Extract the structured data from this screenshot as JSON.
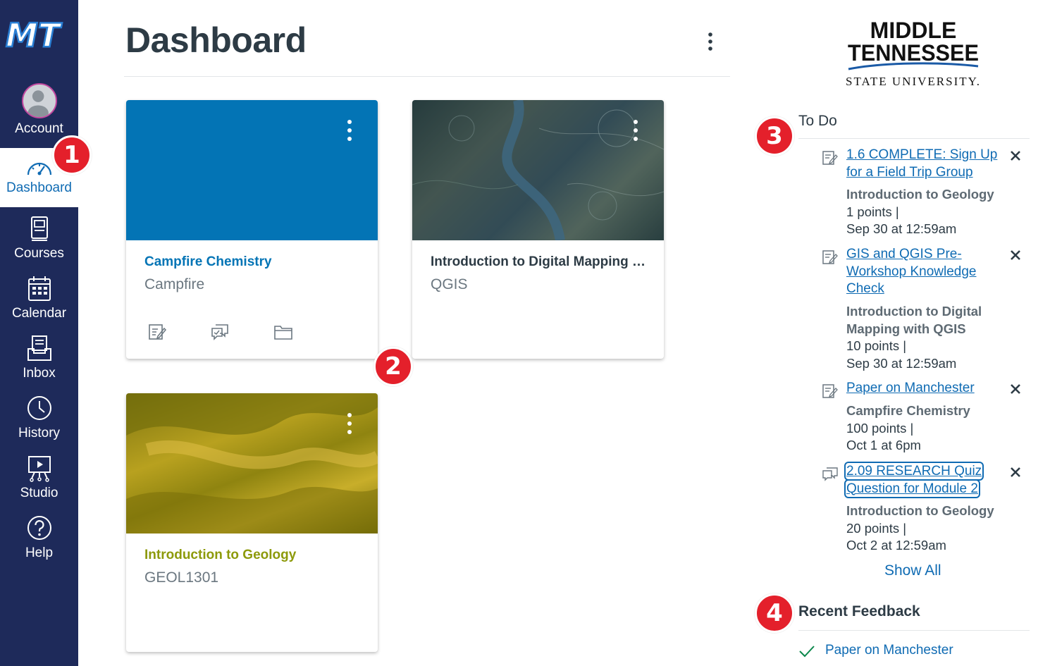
{
  "nav": {
    "logo_text": "MT",
    "items": [
      {
        "label": "Account",
        "icon": "account-avatar"
      },
      {
        "label": "Dashboard",
        "icon": "dashboard-icon",
        "active": true
      },
      {
        "label": "Courses",
        "icon": "courses-icon"
      },
      {
        "label": "Calendar",
        "icon": "calendar-icon"
      },
      {
        "label": "Inbox",
        "icon": "inbox-icon"
      },
      {
        "label": "History",
        "icon": "history-icon"
      },
      {
        "label": "Studio",
        "icon": "studio-icon"
      },
      {
        "label": "Help",
        "icon": "help-icon"
      }
    ]
  },
  "header": {
    "title": "Dashboard"
  },
  "cards": [
    {
      "title": "Campfire Chemistry",
      "subtitle": "Campfire",
      "color": "#0374b5"
    },
    {
      "title": "Introduction to Digital Mapping w...",
      "subtitle": "QGIS",
      "color": "#2d3b45"
    },
    {
      "title": "Introduction to Geology",
      "subtitle": "GEOL1301",
      "color": "#8d9a0b"
    }
  ],
  "badges": [
    "1",
    "2",
    "3",
    "4"
  ],
  "brand": {
    "line1": "MIDDLE",
    "line2": "TENNESSEE",
    "line3": "STATE UNIVERSITY."
  },
  "todo": {
    "heading": "To Do",
    "items": [
      {
        "link_l1": "1.6 COMPLETE: Sign Up",
        "link_l2": "for a Field Trip Group",
        "course_l1": "Introduction to Geology",
        "points": "1 points  |",
        "due": "Sep 30 at 12:59am",
        "icon": "assignment-icon"
      },
      {
        "link_l1": "GIS and QGIS Pre-",
        "link_l2": "Workshop Knowledge",
        "link_l3": "Check",
        "course_l1": "Introduction to Digital",
        "course_l2": "Mapping with QGIS",
        "points": "10 points  |",
        "due": "Sep 30 at 12:59am",
        "icon": "assignment-icon"
      },
      {
        "link_l1": "Paper on Manchester",
        "course_l1": "Campfire Chemistry",
        "points": "100 points  |",
        "due": "Oct 1 at 6pm",
        "icon": "assignment-icon"
      },
      {
        "link_l1": "2.09 RESEARCH Quiz",
        "link_l2": "Question for Module 2",
        "course_l1": "Introduction to Geology",
        "points": "20 points  |",
        "due": "Oct 2 at 12:59am",
        "icon": "discussion-icon"
      }
    ],
    "show_all": "Show All"
  },
  "feedback": {
    "heading": "Recent Feedback",
    "items": [
      {
        "title": "Paper on Manchester",
        "color": "#0b874b"
      }
    ]
  }
}
